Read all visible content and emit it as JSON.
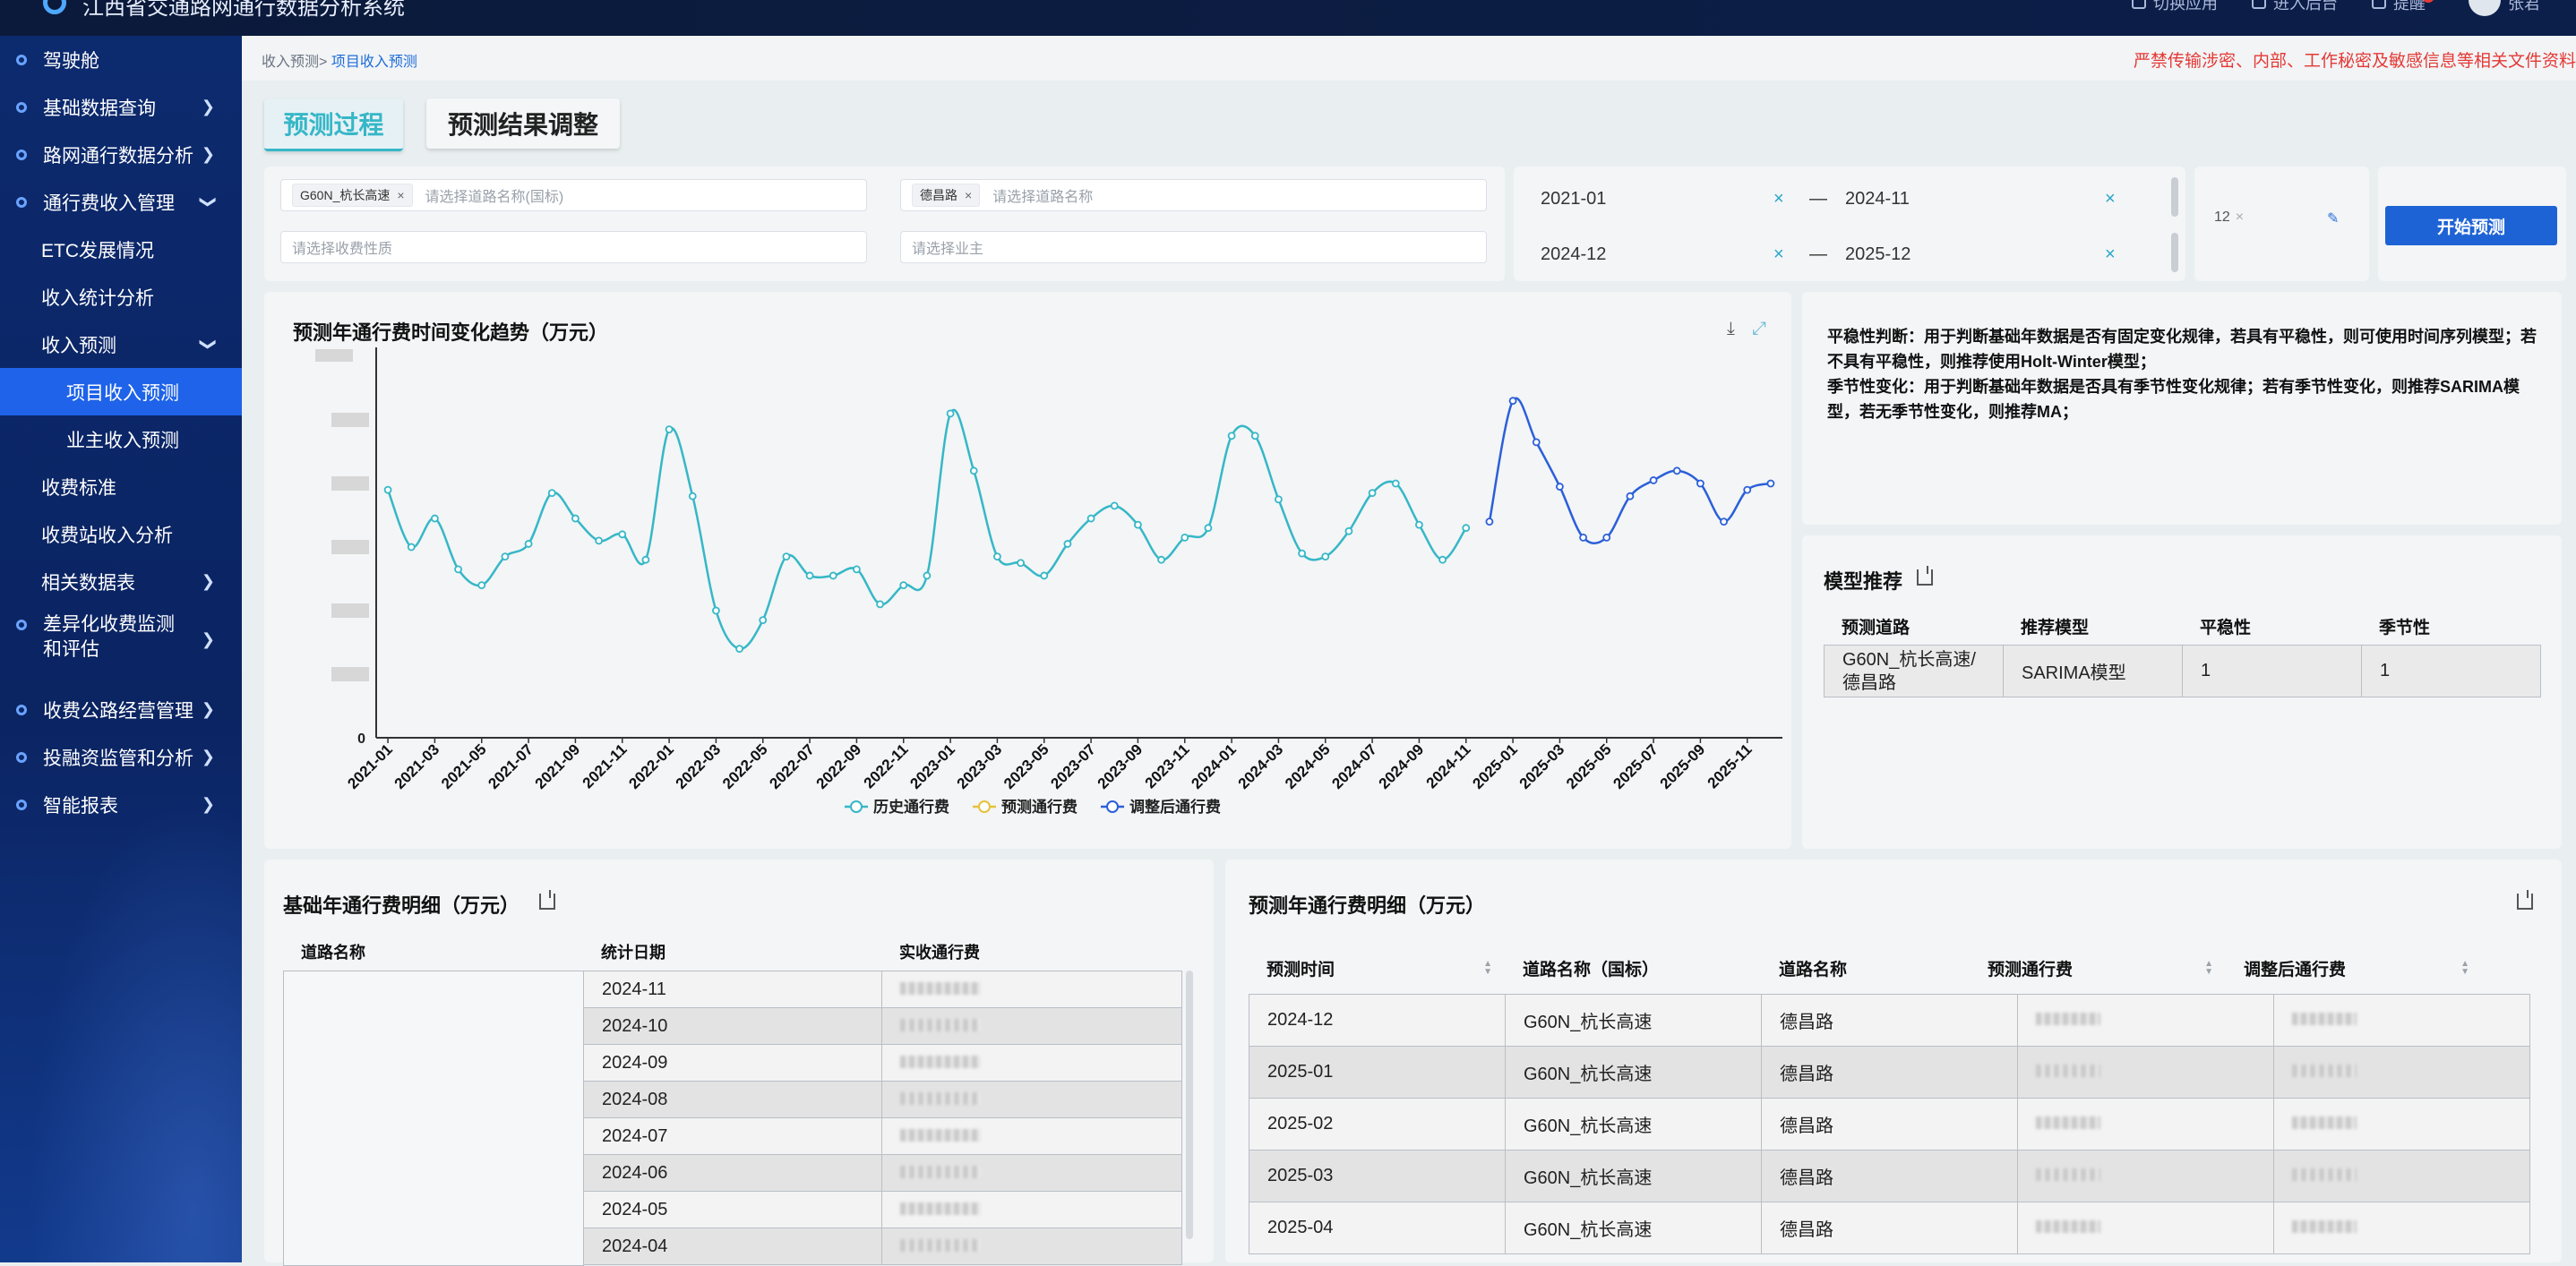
{
  "app": {
    "title": "江西省交通路网通行数据分析系统"
  },
  "topbar": {
    "switch_app": "切换应用",
    "enter_backend": "进入后台",
    "alerts": "提醒",
    "user": "张君"
  },
  "sidebar": {
    "items": [
      {
        "label": "驾驶舱"
      },
      {
        "label": "基础数据查询"
      },
      {
        "label": "路网通行数据分析"
      },
      {
        "label": "通行费收入管理"
      },
      {
        "label": "ETC发展情况"
      },
      {
        "label": "收入统计分析"
      },
      {
        "label": "收入预测"
      },
      {
        "label": "项目收入预测"
      },
      {
        "label": "业主收入预测"
      },
      {
        "label": "收费标准"
      },
      {
        "label": "收费站收入分析"
      },
      {
        "label": "相关数据表"
      },
      {
        "label": "差异化收费监测和评估"
      },
      {
        "label": "收费公路经营管理"
      },
      {
        "label": "投融资监管和分析"
      },
      {
        "label": "智能报表"
      }
    ]
  },
  "breadcrumb": {
    "parent": "收入预测>",
    "current": "项目收入预测"
  },
  "warning": "严禁传输涉密、内部、工作秘密及敏感信息等相关文件资料",
  "tabs": {
    "process": "预测过程",
    "adjust": "预测结果调整"
  },
  "filters": {
    "road_chip": "G60N_杭长高速",
    "road_placeholder": "请选择道路名称(国标)",
    "road2_chip": "德昌路",
    "road2_placeholder": "请选择道路名称",
    "fee_placeholder": "请选择收费性质",
    "owner_placeholder": "请选择业主",
    "base_start": "2021-01",
    "base_end": "2024-11",
    "pred_start": "2024-12",
    "pred_end": "2025-12",
    "range_sep": "—",
    "clear": "×",
    "period_value": "12",
    "start_button": "开始预测"
  },
  "chart_title": "预测年通行费时间变化趋势（万元）",
  "chart_data": {
    "type": "line",
    "title": "预测年通行费时间变化趋势（万元）",
    "x": [
      "2021-01",
      "2021-02",
      "2021-03",
      "2021-04",
      "2021-05",
      "2021-06",
      "2021-07",
      "2021-08",
      "2021-09",
      "2021-10",
      "2021-11",
      "2021-12",
      "2022-01",
      "2022-02",
      "2022-03",
      "2022-04",
      "2022-05",
      "2022-06",
      "2022-07",
      "2022-08",
      "2022-09",
      "2022-10",
      "2022-11",
      "2022-12",
      "2023-01",
      "2023-02",
      "2023-03",
      "2023-04",
      "2023-05",
      "2023-06",
      "2023-07",
      "2023-08",
      "2023-09",
      "2023-10",
      "2023-11",
      "2023-12",
      "2024-01",
      "2024-02",
      "2024-03",
      "2024-04",
      "2024-05",
      "2024-06",
      "2024-07",
      "2024-08",
      "2024-09",
      "2024-10",
      "2024-11",
      "2024-12",
      "2025-01",
      "2025-02",
      "2025-03",
      "2025-04",
      "2025-05",
      "2025-06",
      "2025-07",
      "2025-08",
      "2025-09",
      "2025-10",
      "2025-11",
      "2025-12"
    ],
    "x_tick_labels": [
      "2021-01",
      "2021-03",
      "2021-05",
      "2021-07",
      "2021-09",
      "2021-11",
      "2022-01",
      "2022-03",
      "2022-05",
      "2022-07",
      "2022-09",
      "2022-11",
      "2023-01",
      "2023-03",
      "2023-05",
      "2023-07",
      "2023-09",
      "2023-11",
      "2024-01",
      "2024-03",
      "2024-05",
      "2024-07",
      "2024-09",
      "2024-11",
      "2025-01",
      "2025-03",
      "2025-05",
      "2025-07",
      "2025-09",
      "2025-11"
    ],
    "y_ticks_visible": [
      "0"
    ],
    "ylim": [
      0,
      12
    ],
    "series": [
      {
        "name": "历史通行费",
        "color": "#36b7c7",
        "start_index": 0,
        "values": [
          7.8,
          6.0,
          6.9,
          5.3,
          4.8,
          5.7,
          6.1,
          7.7,
          6.9,
          6.2,
          6.4,
          5.6,
          9.7,
          7.6,
          4.0,
          2.8,
          3.7,
          5.7,
          5.1,
          5.1,
          5.3,
          4.2,
          4.8,
          5.1,
          10.2,
          8.4,
          5.7,
          5.5,
          5.1,
          6.1,
          6.9,
          7.3,
          6.7,
          5.6,
          6.3,
          6.6,
          9.5,
          9.5,
          7.5,
          5.8,
          5.7,
          6.5,
          7.7,
          8.0,
          6.7,
          5.6,
          6.6
        ]
      },
      {
        "name": "预测通行费",
        "color": "#e6c23a",
        "start_index": 47,
        "values": []
      },
      {
        "name": "调整后通行费",
        "color": "#2b5fd9",
        "start_index": 47,
        "values": [
          6.8,
          10.6,
          9.3,
          7.9,
          6.3,
          6.3,
          7.6,
          8.1,
          8.4,
          8.0,
          6.8,
          7.8,
          8.0
        ]
      }
    ],
    "legend": "bottom-center",
    "grid": false
  },
  "description": {
    "stationarity": "平稳性判断：用于判断基础年数据是否有固定变化规律，若具有平稳性，则可使用时间序列模型；若不具有平稳性，则推荐使用Holt-Winter模型；",
    "seasonality": "季节性变化：用于判断基础年数据是否具有季节性变化规律；若有季节性变化，则推荐SARIMA模型，若无季节性变化，则推荐MA；"
  },
  "model": {
    "title": "模型推荐",
    "headers": [
      "预测道路",
      "推荐模型",
      "平稳性",
      "季节性"
    ],
    "row": [
      "G60N_杭长高速/德昌路",
      "SARIMA模型",
      "1",
      "1"
    ]
  },
  "base_table": {
    "title": "基础年通行费明细（万元）",
    "headers": [
      "道路名称",
      "统计日期",
      "实收通行费"
    ],
    "dates": [
      "2024-11",
      "2024-10",
      "2024-09",
      "2024-08",
      "2024-07",
      "2024-06",
      "2024-05",
      "2024-04"
    ]
  },
  "pred_table": {
    "title": "预测年通行费明细（万元）",
    "headers": [
      "预测时间",
      "道路名称（国标）",
      "道路名称",
      "预测通行费",
      "调整后通行费"
    ],
    "rows": [
      [
        "2024-12",
        "G60N_杭长高速",
        "德昌路"
      ],
      [
        "2025-01",
        "G60N_杭长高速",
        "德昌路"
      ],
      [
        "2025-02",
        "G60N_杭长高速",
        "德昌路"
      ],
      [
        "2025-03",
        "G60N_杭长高速",
        "德昌路"
      ],
      [
        "2025-04",
        "G60N_杭长高速",
        "德昌路"
      ]
    ]
  }
}
